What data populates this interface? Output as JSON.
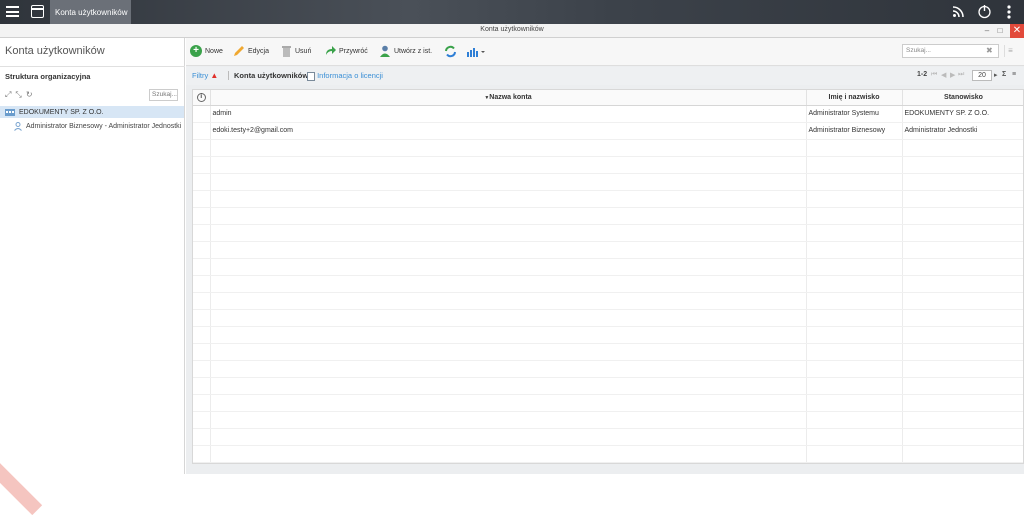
{
  "topbar": {
    "active_tab": "Konta użytkowników"
  },
  "window": {
    "title": "Konta użytkowników"
  },
  "sidebar": {
    "title": "Konta użytkowników",
    "org_title": "Struktura organizacyjna",
    "search_placeholder": "Szukaj...",
    "tree_root": "EDOKUMENTY SP. Z O.O.",
    "tree_child": "Administrator Biznesowy - Administrator Jednostki"
  },
  "toolbar": {
    "new_label": "Nowe",
    "edit_label": "Edycja",
    "delete_label": "Usuń",
    "restore_label": "Przywróć",
    "create_from_label": "Utwórz z ist.",
    "search_placeholder": "Szukaj..."
  },
  "filterbar": {
    "filters_label": "Filtry",
    "breadcrumb": "Konta użytkowników",
    "license_link": "Informacja o licencji",
    "range": "1-2",
    "page_size": "20"
  },
  "table": {
    "columns": [
      "Nazwa konta",
      "Imię i nazwisko",
      "Stanowisko"
    ],
    "rows": [
      [
        "admin",
        "Administrator Systemu",
        "EDOKUMENTY SP. Z O.O."
      ],
      [
        "edoki.testy+2@gmail.com",
        "Administrator Biznesowy",
        "Administrator Jednostki"
      ]
    ]
  },
  "colors": {
    "accent": "#3a8fd6",
    "selection": "#d7e6f5",
    "close": "#e24a3b",
    "warning": "#e0302a"
  }
}
